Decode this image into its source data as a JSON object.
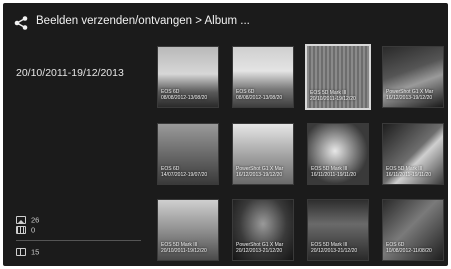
{
  "header": {
    "title": "Beelden verzenden/ontvangen > Album ...",
    "share_icon": "share-icon"
  },
  "sidebar": {
    "date_range": "20/10/2011-19/12/2013",
    "photo_count": "26",
    "movie_count": "0",
    "album_count": "15"
  },
  "thumbnails": [
    {
      "camera": "EOS 6D",
      "date": "08/08/2012-13/08/20",
      "selected": false
    },
    {
      "camera": "EOS 6D",
      "date": "08/08/2012-13/08/20",
      "selected": false
    },
    {
      "camera": "EOS 5D Mark III",
      "date": "20/10/2011-19/12/20",
      "selected": true
    },
    {
      "camera": "PowerShot G1 X Mar",
      "date": "16/12/2013-19/12/20",
      "selected": false
    },
    {
      "camera": "EOS 6D",
      "date": "14/07/2012-19/07/20",
      "selected": false
    },
    {
      "camera": "PowerShot G1 X Mar",
      "date": "16/12/2013-19/12/20",
      "selected": false
    },
    {
      "camera": "EOS 5D Mark III",
      "date": "16/11/2011-19/11/20",
      "selected": false
    },
    {
      "camera": "EOS 5D Mark III",
      "date": "16/11/2011-19/11/20",
      "selected": false
    },
    {
      "camera": "EOS 5D Mark III",
      "date": "20/10/2011-19/12/20",
      "selected": false
    },
    {
      "camera": "PowerShot G1 X Mar",
      "date": "20/12/2013-21/12/20",
      "selected": false
    },
    {
      "camera": "EOS 5D Mark III",
      "date": "20/12/2013-21/12/20",
      "selected": false
    },
    {
      "camera": "EOS 6D",
      "date": "10/08/2012-11/08/20",
      "selected": false
    }
  ]
}
